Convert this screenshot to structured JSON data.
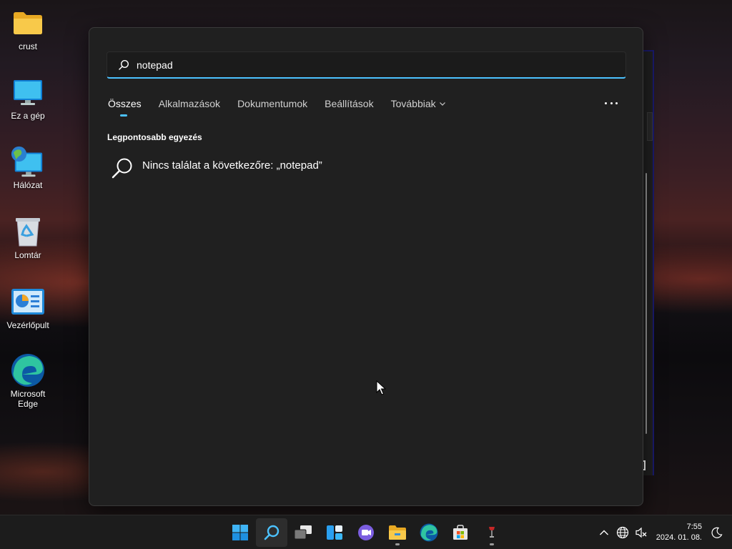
{
  "desktop": {
    "icons": [
      {
        "label": "crust",
        "icon": "folder-icon"
      },
      {
        "label": "Ez a gép",
        "icon": "computer-icon"
      },
      {
        "label": "Hálózat",
        "icon": "network-icon"
      },
      {
        "label": "Lomtár",
        "icon": "recycle-bin-icon"
      },
      {
        "label": "Vezérlőpult",
        "icon": "control-panel-icon"
      },
      {
        "label": "Microsoft Edge",
        "icon": "edge-icon"
      }
    ]
  },
  "search": {
    "query": "notepad",
    "tabs": [
      {
        "label": "Összes",
        "active": true
      },
      {
        "label": "Alkalmazások",
        "active": false
      },
      {
        "label": "Dokumentumok",
        "active": false
      },
      {
        "label": "Beállítások",
        "active": false
      },
      {
        "label": "Továbbiak",
        "active": false
      }
    ],
    "section_title": "Legpontosabb egyezés",
    "no_result_text": "Nincs találat a következőre: „notepad”"
  },
  "taskbar": {
    "apps": [
      "start-icon",
      "search-icon",
      "task-view-icon",
      "widgets-icon",
      "chat-icon",
      "file-explorer-icon",
      "edge-icon",
      "store-icon",
      "app-icon"
    ],
    "time": "7:55",
    "date": "2024. 01. 08."
  },
  "colors": {
    "accent": "#4cc2ff",
    "panel": "#202020",
    "taskbar": "#1c1c1c"
  }
}
